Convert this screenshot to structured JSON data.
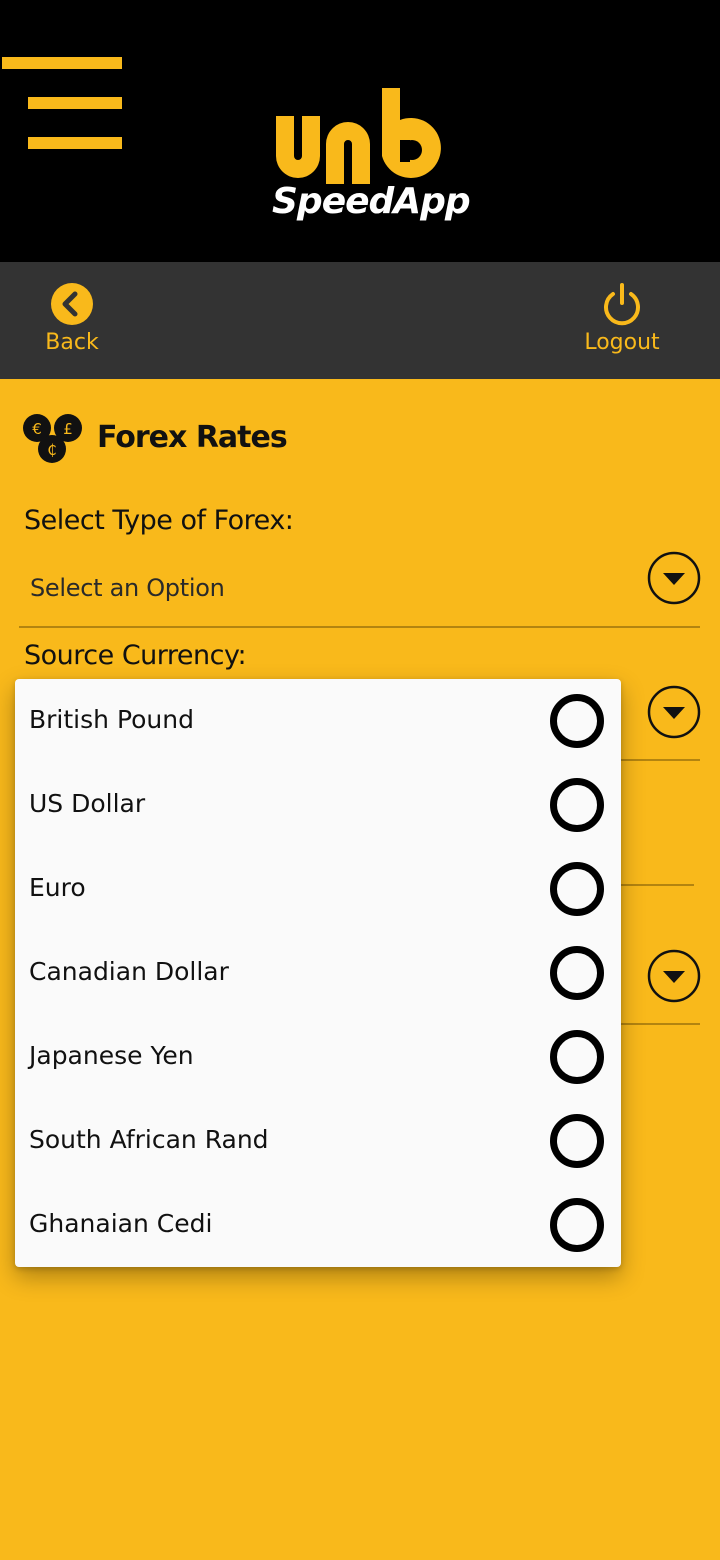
{
  "header": {
    "logo_mark": "umb",
    "logo_text": "SpeedApp"
  },
  "toolbar": {
    "back_label": "Back",
    "logout_label": "Logout"
  },
  "page": {
    "title": "Forex Rates"
  },
  "form": {
    "forex_type_label": "Select Type of Forex:",
    "forex_type_value": "Select an Option",
    "source_currency_label": "Source Currency:"
  },
  "currency_options": [
    {
      "label": "British Pound",
      "selected": false
    },
    {
      "label": "US Dollar",
      "selected": false
    },
    {
      "label": "Euro",
      "selected": false
    },
    {
      "label": "Canadian Dollar",
      "selected": false
    },
    {
      "label": "Japanese Yen",
      "selected": false
    },
    {
      "label": "South African Rand",
      "selected": false
    },
    {
      "label": "Ghanaian Cedi",
      "selected": false
    }
  ],
  "icons": {
    "menu": "hamburger-menu-icon",
    "back": "chevron-left-circle-icon",
    "logout": "power-icon",
    "forex": "currency-coins-icon",
    "dropdown": "chevron-down-circle-icon"
  },
  "colors": {
    "accent": "#F9B91B",
    "header_bg": "#000000",
    "toolbar_bg": "#333333",
    "popup_bg": "#FAFAFA"
  }
}
